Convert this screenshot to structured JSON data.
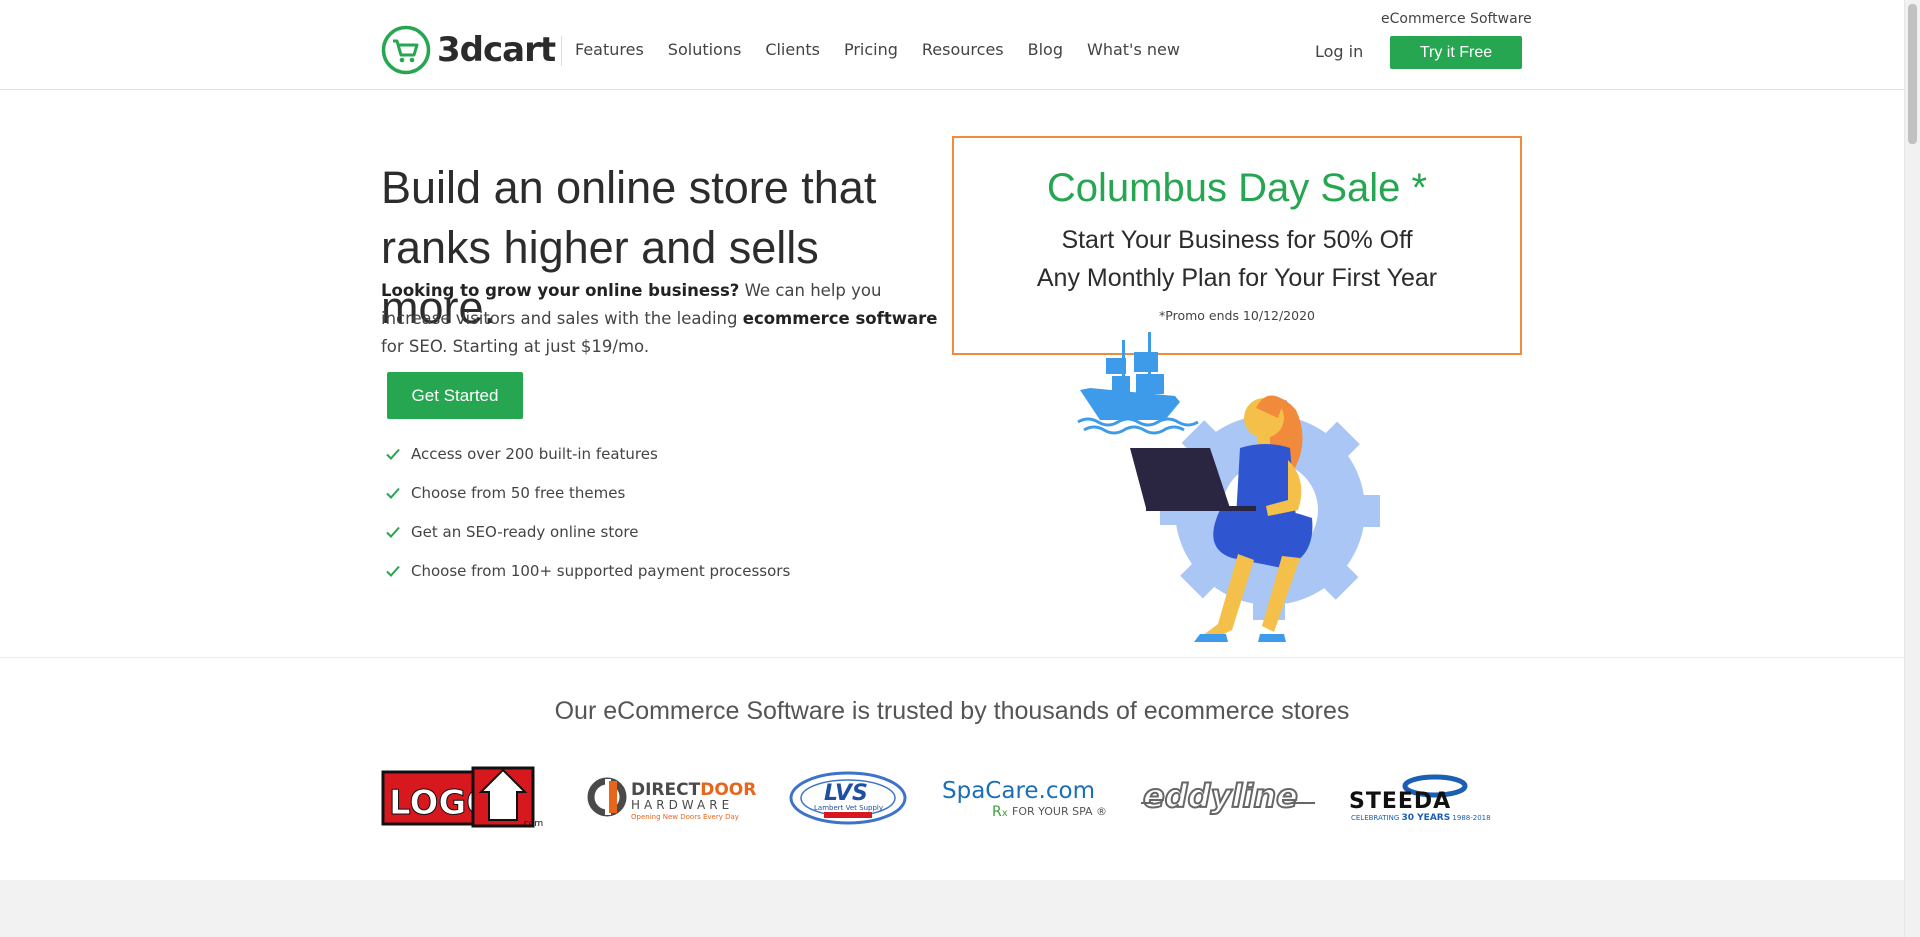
{
  "header": {
    "brand": "3dcart",
    "top_tag": "eCommerce Software",
    "nav": [
      "Features",
      "Solutions",
      "Clients",
      "Pricing",
      "Resources",
      "Blog",
      "What's new"
    ],
    "login": "Log in",
    "cta": "Try it Free"
  },
  "hero": {
    "title": "Build an online store that ranks higher and sells more.",
    "copy_lead": "Looking to grow your online business?",
    "copy_mid": " We can help you increase visitors and sales with the leading ",
    "copy_bold": "ecommerce software",
    "copy_tail": " for SEO. Starting at just $19/mo.",
    "button": "Get Started",
    "features": [
      "Access over 200 built-in features",
      "Choose from 50 free themes",
      "Get an SEO-ready online store",
      "Choose from 100+ supported payment processors"
    ]
  },
  "promo": {
    "title": "Columbus Day Sale *",
    "line1": "Start Your Business for 50% Off",
    "line2": "Any Monthly Plan for Your First Year",
    "note": "*Promo ends 10/12/2020"
  },
  "trust": {
    "title": "Our eCommerce Software is trusted by thousands of ecommerce stores",
    "logos": [
      "LogoUp.com",
      "DirectDoor Hardware",
      "LVS Lambert Vet Supply",
      "SpaCare.com Rx For Your Spa",
      "eddyline",
      "STEEDA 30 Years"
    ]
  },
  "colors": {
    "brand_green": "#26a651",
    "promo_border": "#f28a3c",
    "ship_blue": "#3e9be9",
    "gear_blue": "#a9c6f5",
    "dress_blue": "#2f56d0"
  }
}
